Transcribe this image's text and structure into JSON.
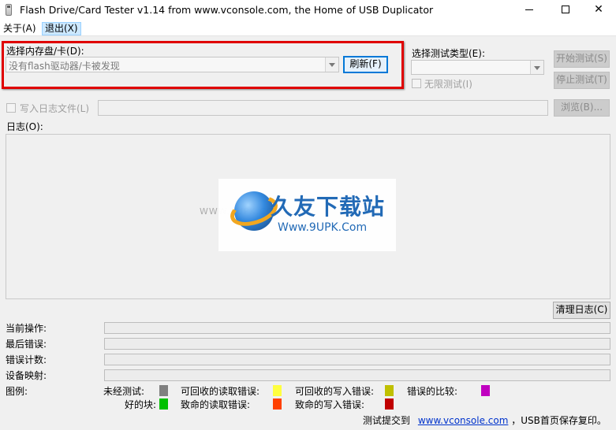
{
  "window": {
    "title": "Flash Drive/Card Tester v1.14 from www.vconsole.com, the Home of USB Duplicator"
  },
  "menu": {
    "about": "关于(A)",
    "exit": "退出(X)"
  },
  "drive_select": {
    "label": "选择内存盘/卡(D):",
    "value": "没有flash驱动器/卡被发现",
    "refresh_button": "刷新(F)"
  },
  "test_type": {
    "label": "选择测试类型(E):",
    "value": "",
    "infinite_label": "无限测试(I)",
    "start_button": "开始测试(S)",
    "stop_button": "停止测试(T)"
  },
  "log_file": {
    "checkbox_label": "写入日志文件(L)",
    "path_value": "",
    "browse_button": "浏览(B)..."
  },
  "log": {
    "label": "日志(O):",
    "clear_button": "清理日志(C)"
  },
  "status": {
    "current_op_label": "当前操作:",
    "last_error_label": "最后错误:",
    "error_count_label": "错误计数:",
    "device_map_label": "设备映射:"
  },
  "legend": {
    "label": "图例:",
    "items": [
      {
        "label": "未经测试:",
        "color": "#808080"
      },
      {
        "label": "可回收的读取错误:",
        "color": "#ffff40"
      },
      {
        "label": "可回收的写入错误:",
        "color": "#c0c000"
      },
      {
        "label": "错误的比较:",
        "color": "#c000c0"
      },
      {
        "label": "好的块:",
        "color": "#00c000"
      },
      {
        "label": "致命的读取错误:",
        "color": "#ff4000"
      },
      {
        "label": "致命的写入错误:",
        "color": "#c00000"
      }
    ]
  },
  "footer": {
    "prefix": "测试提交到",
    "link": "www.vconsole.com",
    "suffix": "，USB首页保存复印。"
  },
  "watermark": {
    "title": "久友下载站",
    "url": "Www.9UPK.Com",
    "left_text": "WWW.9UPK.COM"
  },
  "colors": {
    "highlight": "#e00000",
    "accent": "#0078d7",
    "link": "#0033cc"
  }
}
